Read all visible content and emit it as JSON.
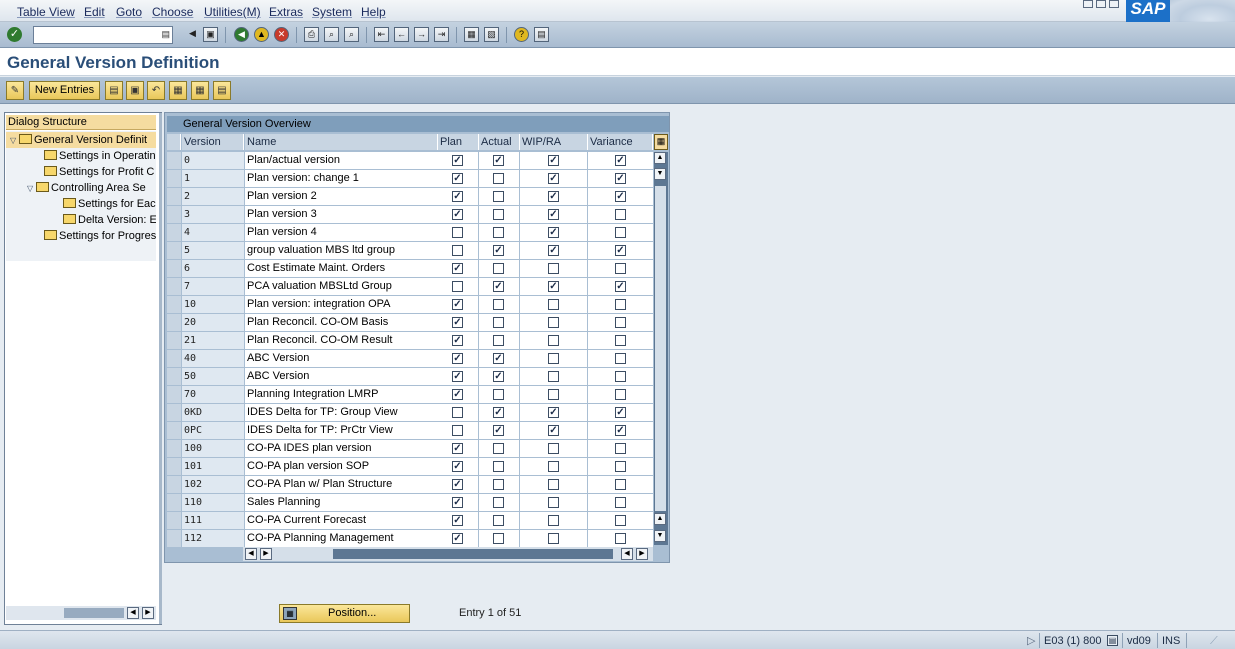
{
  "menu": [
    "Table View",
    "Edit",
    "Goto",
    "Choose",
    "Utilities(M)",
    "Extras",
    "System",
    "Help"
  ],
  "logo": "SAP",
  "title": "General Version Definition",
  "app_toolbar": {
    "new_entries_label": "New Entries"
  },
  "dialog_structure": {
    "header": "Dialog Structure",
    "nodes": [
      "General Version Definit",
      "Settings in Operatin",
      "Settings for Profit C",
      "Controlling Area Se",
      "Settings for Eac",
      "Delta Version: E",
      "Settings for Progres"
    ]
  },
  "table": {
    "title": "General Version Overview",
    "columns": [
      "Version",
      "Name",
      "Plan",
      "Actual",
      "WIP/RA",
      "Variance"
    ],
    "rows": [
      {
        "version": "0",
        "name": "Plan/actual version",
        "flags": [
          true,
          true,
          true,
          true
        ]
      },
      {
        "version": "1",
        "name": "Plan version: change 1",
        "flags": [
          true,
          false,
          true,
          true
        ]
      },
      {
        "version": "2",
        "name": "Plan version 2",
        "flags": [
          true,
          false,
          true,
          true
        ]
      },
      {
        "version": "3",
        "name": "Plan version 3",
        "flags": [
          true,
          false,
          true,
          false
        ]
      },
      {
        "version": "4",
        "name": "Plan version 4",
        "flags": [
          false,
          false,
          true,
          false
        ]
      },
      {
        "version": "5",
        "name": "group valuation MBS ltd group",
        "flags": [
          false,
          true,
          true,
          true
        ]
      },
      {
        "version": "6",
        "name": "Cost Estimate Maint. Orders",
        "flags": [
          true,
          false,
          false,
          false
        ]
      },
      {
        "version": "7",
        "name": "PCA valuation MBSLtd Group",
        "flags": [
          false,
          true,
          true,
          true
        ]
      },
      {
        "version": "10",
        "name": "Plan version: integration OPA",
        "flags": [
          true,
          false,
          false,
          false
        ]
      },
      {
        "version": "20",
        "name": "Plan Reconcil. CO-OM Basis",
        "flags": [
          true,
          false,
          false,
          false
        ]
      },
      {
        "version": "21",
        "name": "Plan Reconcil. CO-OM Result",
        "flags": [
          true,
          false,
          false,
          false
        ]
      },
      {
        "version": "40",
        "name": "ABC Version",
        "flags": [
          true,
          true,
          false,
          false
        ]
      },
      {
        "version": "50",
        "name": "ABC Version",
        "flags": [
          true,
          true,
          false,
          false
        ]
      },
      {
        "version": "70",
        "name": "Planning Integration LMRP",
        "flags": [
          true,
          false,
          false,
          false
        ]
      },
      {
        "version": "0KD",
        "name": "IDES Delta for TP: Group View",
        "flags": [
          false,
          true,
          true,
          true
        ]
      },
      {
        "version": "0PC",
        "name": "IDES Delta for TP: PrCtr View",
        "flags": [
          false,
          true,
          true,
          true
        ]
      },
      {
        "version": "100",
        "name": "CO-PA IDES plan version",
        "flags": [
          true,
          false,
          false,
          false
        ]
      },
      {
        "version": "101",
        "name": "CO-PA plan version SOP",
        "flags": [
          true,
          false,
          false,
          false
        ]
      },
      {
        "version": "102",
        "name": "CO-PA Plan w/ Plan Structure",
        "flags": [
          true,
          false,
          false,
          false
        ]
      },
      {
        "version": "110",
        "name": "Sales Planning",
        "flags": [
          true,
          false,
          false,
          false
        ]
      },
      {
        "version": "111",
        "name": "CO-PA Current Forecast",
        "flags": [
          true,
          false,
          false,
          false
        ]
      },
      {
        "version": "112",
        "name": "CO-PA Planning Management",
        "flags": [
          true,
          false,
          false,
          false
        ]
      }
    ]
  },
  "position_button": "Position...",
  "entry_info": "Entry 1 of 51",
  "status": {
    "system": "E03 (1) 800",
    "server": "vd09",
    "mode": "INS"
  }
}
